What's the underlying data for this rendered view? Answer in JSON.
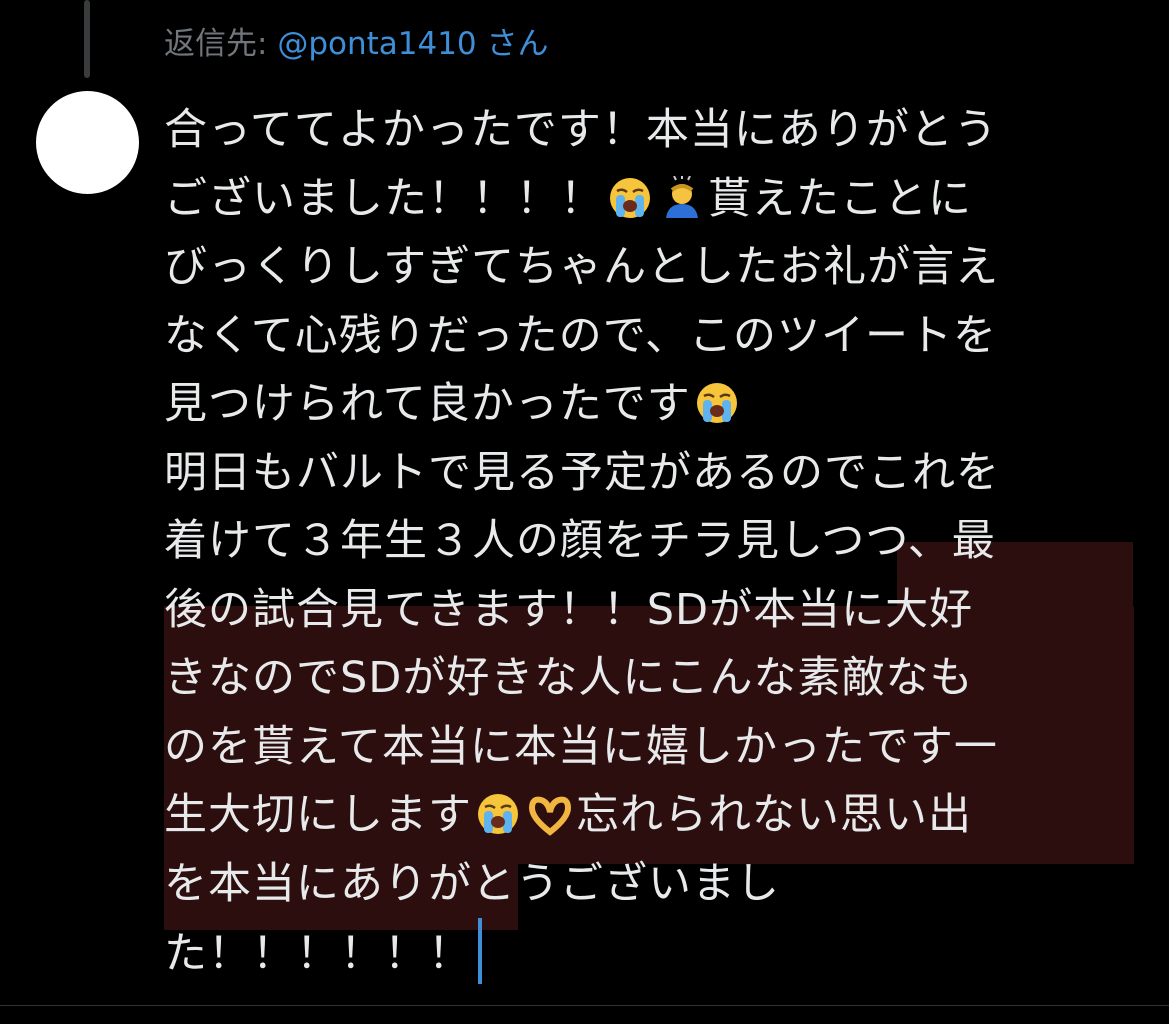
{
  "reply": {
    "prefix": "返信先: ",
    "mention": "@ponta1410",
    "suffix": " さん"
  },
  "tweet": {
    "l1": "合っててよかったです！本当にありがとう",
    "l2a": "ございました！！！！",
    "l2b": "貰えたことに",
    "l3": "びっくりしすぎてちゃんとしたお礼が言え",
    "l4": "なくて心残りだったので、このツイートを",
    "l5": "見つけられて良かったです",
    "l6": "明日もバルトで見る予定があるのでこれを",
    "l7": "着けて３年生３人の顔をチラ見しつつ、最",
    "l8a": "後の試合見てきます！！SDが本",
    "l8b": "当に大好",
    "l9": "きなのでSDが好きな人にこんな素敵なも",
    "l10": "のを貰えて本当に本当に嬉しかったです一",
    "l11a": "生大切にします",
    "l11b": "忘れられない思い出",
    "l12": "を本当にありがとうございまし",
    "l13": "た！！！！！！"
  },
  "emojis": {
    "crying": "loudly-crying-face-emoji",
    "bowing": "person-bowing-emoji",
    "heart_hands": "heart-hands-emoji"
  },
  "colors": {
    "background": "#000000",
    "text": "#e7e9ea",
    "secondary": "#71767b",
    "link": "#3e8ed8",
    "highlight": "#2c0e0f"
  }
}
